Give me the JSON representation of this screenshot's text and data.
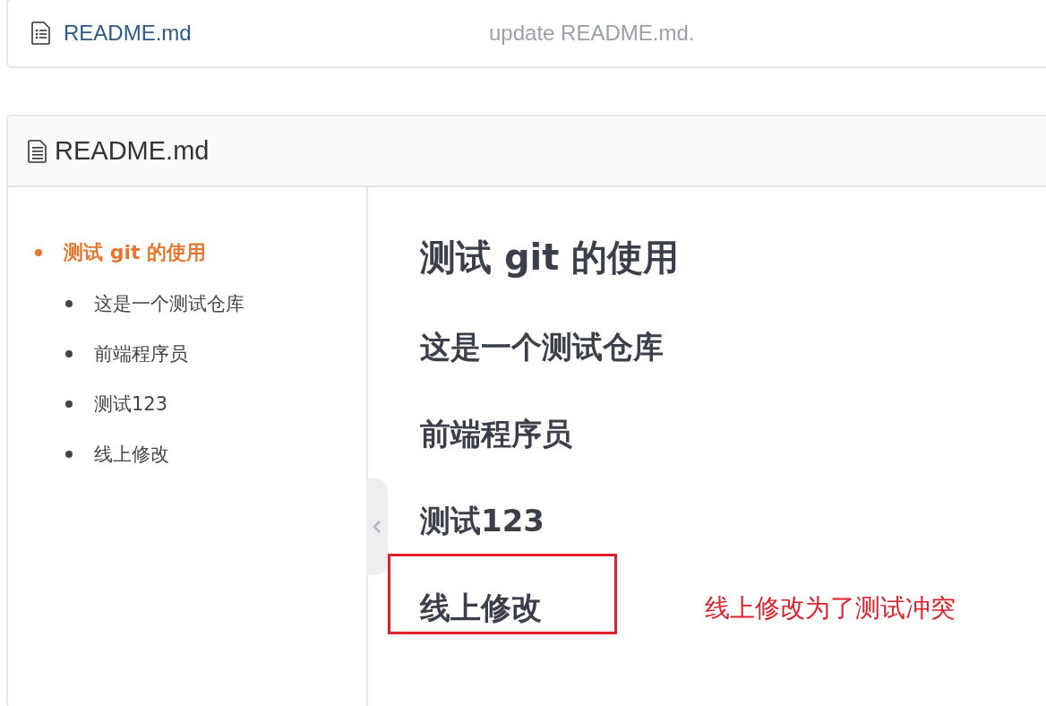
{
  "file_list": [
    {
      "name": "README.md",
      "commit_message": "update README.md."
    }
  ],
  "readme": {
    "title": "README.md",
    "toc": [
      {
        "text": "测试 git 的使用",
        "selected": true,
        "children": [
          {
            "text": "这是一个测试仓库",
            "selected": false
          },
          {
            "text": "前端程序员",
            "selected": false
          },
          {
            "text": "测试123",
            "selected": false
          },
          {
            "text": "线上修改",
            "selected": false
          }
        ]
      }
    ],
    "content": [
      {
        "kind": "h1",
        "text": "测试 git 的使用",
        "highlighted": false
      },
      {
        "kind": "h2",
        "text": "这是一个测试仓库",
        "highlighted": false
      },
      {
        "kind": "h2",
        "text": "前端程序员",
        "highlighted": false
      },
      {
        "kind": "h2",
        "text": "测试123",
        "highlighted": false
      },
      {
        "kind": "h2",
        "text": "线上修改",
        "highlighted": true,
        "annotation": "线上修改为了测试冲突"
      }
    ]
  }
}
